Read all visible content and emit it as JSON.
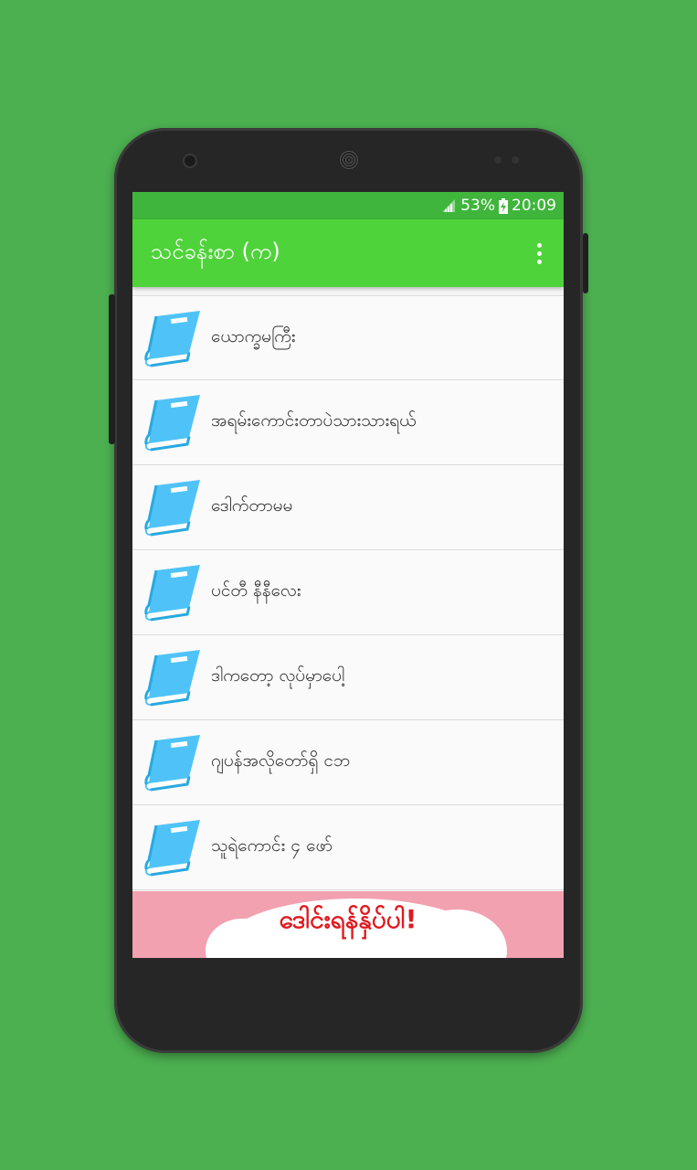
{
  "status_bar": {
    "battery": "53%",
    "time": "20:09",
    "icons": [
      "signal-icon",
      "battery-charging-icon"
    ]
  },
  "app_bar": {
    "title": "သင်ခန်းစာ (က)",
    "menu_icon": "overflow-menu-icon"
  },
  "list": {
    "icon": "book-icon",
    "items": [
      {
        "label": "ယောက္ခမကြီး"
      },
      {
        "label": "အရမ်းကောင်းတာပဲသားသားရယ်"
      },
      {
        "label": "ဒေါက်တာမမ"
      },
      {
        "label": "ပင်တီ နီနီလေး"
      },
      {
        "label": "ဒါကတော့ လုပ်မှာပေါ့"
      },
      {
        "label": "ဂျပန်အလိုတော်ရှိ ငဘ"
      },
      {
        "label": "သူရဲကောင်း ၄ ဖော်"
      }
    ]
  },
  "banner": {
    "text": "ဒေါင်းရန်နှိပ်ပါ!"
  },
  "colors": {
    "background": "#4caf50",
    "status_bar": "#3fb53b",
    "app_bar": "#4fd33a",
    "book_icon": "#4fc3f7",
    "banner_bg": "#f2a1b1",
    "banner_text": "#e0181f"
  }
}
